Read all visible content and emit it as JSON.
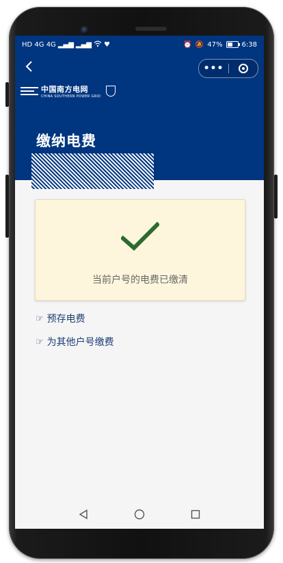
{
  "status_bar": {
    "left_indicators": "HD 4G 4G",
    "battery_percent": "47%",
    "time": "6:38",
    "battery_level": 0.47
  },
  "header": {
    "logo_cn": "中国南方电网",
    "logo_en": "CHINA SOUTHERN POWER GRID",
    "title": "缴纳电费"
  },
  "card": {
    "message": "当前户号的电费已缴清"
  },
  "links": [
    {
      "label": "预存电费"
    },
    {
      "label": "为其他户号缴费"
    }
  ],
  "colors": {
    "brand": "#003580",
    "card_bg": "#fdf6dc",
    "check": "#2e6b2e",
    "link": "#1f3e73"
  }
}
